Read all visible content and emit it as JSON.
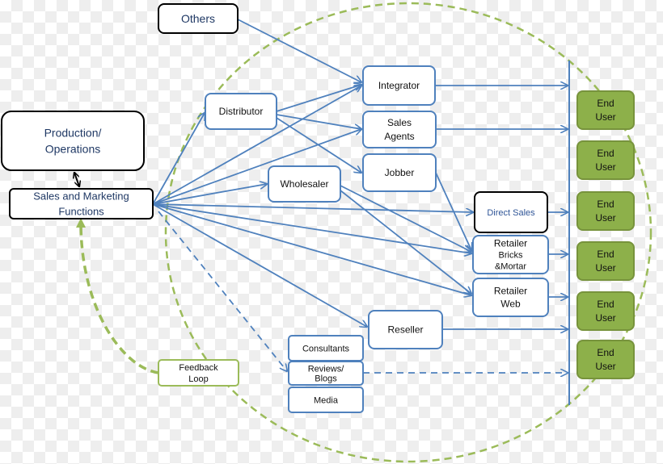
{
  "colors": {
    "flow": "#4f81bd",
    "feedback": "#9bbb59",
    "end_user_fill": "#8db04a",
    "end_user_border": "#77933c",
    "text_blue": "#1f3864"
  },
  "nodes": {
    "others": [
      "Others"
    ],
    "production": [
      "Production/",
      "Operations"
    ],
    "sales_marketing": [
      "Sales and Marketing",
      "Functions"
    ],
    "distributor": [
      "Distributor"
    ],
    "integrator": [
      "Integrator"
    ],
    "sales_agents": [
      "Sales",
      "Agents"
    ],
    "jobber": [
      "Jobber"
    ],
    "wholesaler": [
      "Wholesaler"
    ],
    "direct_sales": [
      "Direct Sales"
    ],
    "retailer_bricks": [
      "Retailer",
      "Bricks",
      "&Mortar"
    ],
    "retailer_web": [
      "Retailer",
      "Web"
    ],
    "reseller": [
      "Reseller"
    ],
    "consultants": [
      "Consultants"
    ],
    "reviews_blogs": [
      "Reviews/",
      "Blogs"
    ],
    "media": [
      "Media"
    ],
    "feedback_loop": [
      "Feedback",
      "Loop"
    ]
  },
  "end_users": [
    [
      "End",
      "User"
    ],
    [
      "End",
      "User"
    ],
    [
      "End",
      "User"
    ],
    [
      "End",
      "User"
    ],
    [
      "End",
      "User"
    ],
    [
      "End",
      "User"
    ]
  ]
}
